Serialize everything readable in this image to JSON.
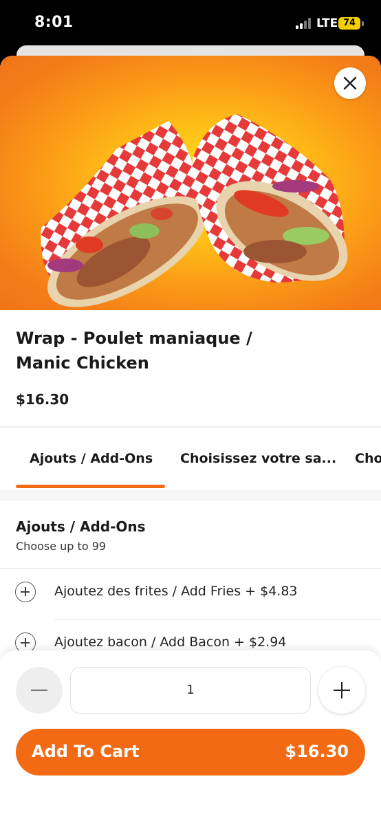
{
  "status_bar": {
    "time": "8:01",
    "network": "LTE",
    "battery": "74"
  },
  "item": {
    "image": "wrap-photo",
    "title": "Wrap - Poulet maniaque / Manic Chicken",
    "price": "$16.30"
  },
  "tabs": [
    {
      "label": "Ajouts / Add-Ons",
      "active": true
    },
    {
      "label": "Choisissez votre sa..."
    },
    {
      "label": "Cho"
    }
  ],
  "section": {
    "title": "Ajouts / Add-Ons",
    "subtitle": "Choose up to 99",
    "options": [
      {
        "label": "Ajoutez des frites / Add Fries + $4.83"
      },
      {
        "label": "Ajoutez bacon / Add Bacon + $2.94"
      }
    ]
  },
  "quantity": {
    "value": "1"
  },
  "cart_button": {
    "label": "Add To Cart",
    "price": "$16.30"
  },
  "colors": {
    "accent": "#f26b14",
    "hero_center": "#ffe21a",
    "hero_edge": "#f07317"
  },
  "icons": [
    "close-icon",
    "plus-circle-icon",
    "minus-icon",
    "plus-icon",
    "signal-icon",
    "battery-icon"
  ]
}
